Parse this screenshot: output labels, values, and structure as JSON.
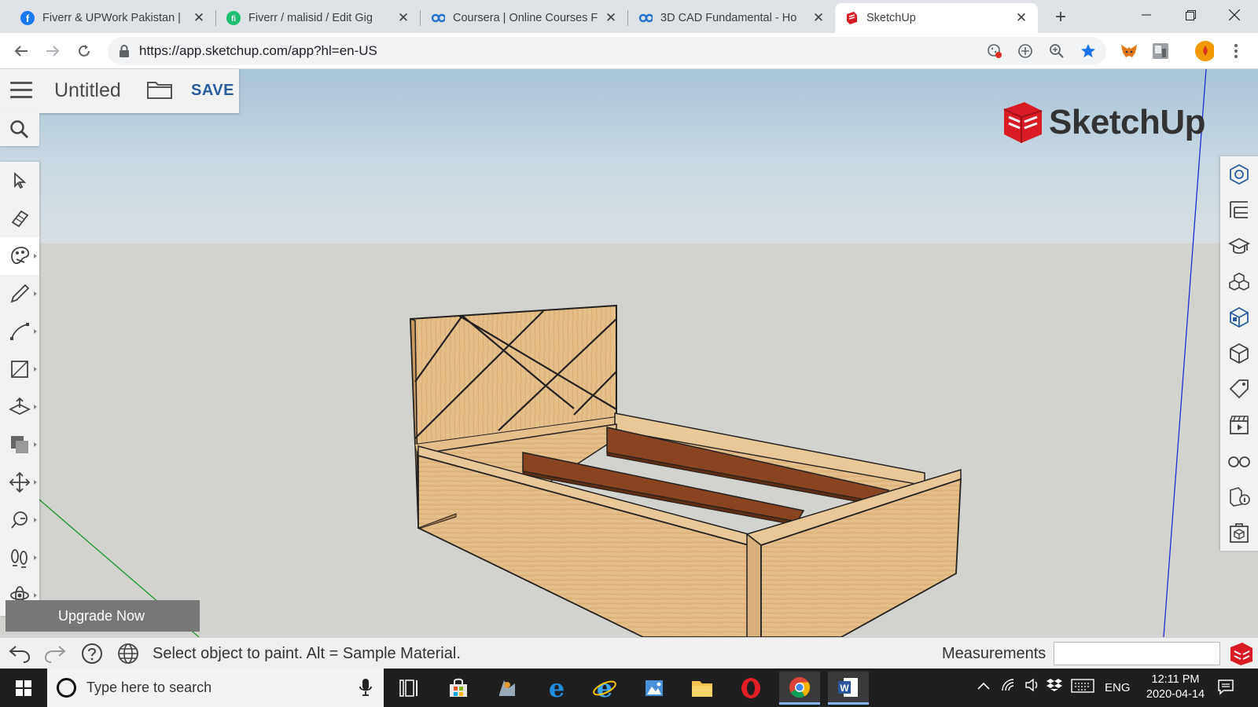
{
  "browser": {
    "tabs": [
      {
        "title": "Fiverr & UPWork Pakistan |",
        "favicon": "facebook-icon",
        "color": "#1877f2",
        "active": false
      },
      {
        "title": "Fiverr / malisid / Edit Gig",
        "favicon": "fiverr-icon",
        "color": "#1dbf73",
        "active": false
      },
      {
        "title": "Coursera | Online Courses F",
        "favicon": "coursera-icon",
        "color": "#2a73cc",
        "active": false
      },
      {
        "title": "3D CAD Fundamental - Ho",
        "favicon": "coursera-icon",
        "color": "#2a73cc",
        "active": false
      },
      {
        "title": "SketchUp",
        "favicon": "sketchup-icon",
        "color": "#d91c24",
        "active": true
      }
    ],
    "url": "https://app.sketchup.com/app?hl=en-US"
  },
  "app": {
    "doc_title": "Untitled",
    "save_label": "SAVE",
    "logo_text": "SketchUp",
    "upgrade_label": "Upgrade Now",
    "left_tools": [
      {
        "name": "select-tool",
        "icon": "cursor-icon",
        "selected": false
      },
      {
        "name": "eraser-tool",
        "icon": "eraser-icon",
        "selected": false
      },
      {
        "name": "paint-bucket-tool",
        "icon": "paint-bucket-icon",
        "selected": true
      },
      {
        "name": "pencil-tool",
        "icon": "pencil-icon",
        "selected": false
      },
      {
        "name": "arc-tool",
        "icon": "arc-icon",
        "selected": false
      },
      {
        "name": "rectangle-tool",
        "icon": "rectangle-icon",
        "selected": false
      },
      {
        "name": "push-pull-tool",
        "icon": "push-pull-icon",
        "selected": false
      },
      {
        "name": "offset-tool",
        "icon": "offset-icon",
        "selected": false
      },
      {
        "name": "move-tool",
        "icon": "move-icon",
        "selected": false
      },
      {
        "name": "tape-measure-tool",
        "icon": "tape-measure-icon",
        "selected": false
      },
      {
        "name": "walk-tool",
        "icon": "footprints-icon",
        "selected": false
      },
      {
        "name": "orbit-tool",
        "icon": "orbit-icon",
        "selected": false
      }
    ],
    "right_panels": [
      "entity-info-icon",
      "outliner-icon",
      "instructor-icon",
      "components-icon",
      "materials-icon",
      "styles-icon",
      "tags-icon",
      "scenes-icon",
      "display-icon",
      "solar-icon",
      "3d-warehouse-icon"
    ],
    "status_text": "Select object to paint. Alt = Sample Material.",
    "measurements_label": "Measurements",
    "measurements_value": ""
  },
  "taskbar": {
    "search_placeholder": "Type here to search",
    "language": "ENG",
    "time": "12:11 PM",
    "date": "2020-04-14"
  },
  "colors": {
    "wood_light": "#e2bc84",
    "wood_dark": "#8b4420",
    "sketchup_red": "#d91c24",
    "save_blue": "#2a5d9f"
  }
}
